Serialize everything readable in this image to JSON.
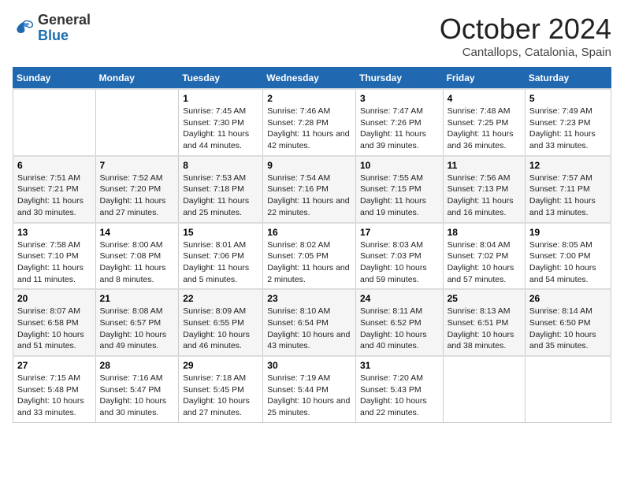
{
  "header": {
    "logo_general": "General",
    "logo_blue": "Blue",
    "month": "October 2024",
    "location": "Cantallops, Catalonia, Spain"
  },
  "days_of_week": [
    "Sunday",
    "Monday",
    "Tuesday",
    "Wednesday",
    "Thursday",
    "Friday",
    "Saturday"
  ],
  "weeks": [
    [
      {
        "day": "",
        "sunrise": "",
        "sunset": "",
        "daylight": ""
      },
      {
        "day": "",
        "sunrise": "",
        "sunset": "",
        "daylight": ""
      },
      {
        "day": "1",
        "sunrise": "Sunrise: 7:45 AM",
        "sunset": "Sunset: 7:30 PM",
        "daylight": "Daylight: 11 hours and 44 minutes."
      },
      {
        "day": "2",
        "sunrise": "Sunrise: 7:46 AM",
        "sunset": "Sunset: 7:28 PM",
        "daylight": "Daylight: 11 hours and 42 minutes."
      },
      {
        "day": "3",
        "sunrise": "Sunrise: 7:47 AM",
        "sunset": "Sunset: 7:26 PM",
        "daylight": "Daylight: 11 hours and 39 minutes."
      },
      {
        "day": "4",
        "sunrise": "Sunrise: 7:48 AM",
        "sunset": "Sunset: 7:25 PM",
        "daylight": "Daylight: 11 hours and 36 minutes."
      },
      {
        "day": "5",
        "sunrise": "Sunrise: 7:49 AM",
        "sunset": "Sunset: 7:23 PM",
        "daylight": "Daylight: 11 hours and 33 minutes."
      }
    ],
    [
      {
        "day": "6",
        "sunrise": "Sunrise: 7:51 AM",
        "sunset": "Sunset: 7:21 PM",
        "daylight": "Daylight: 11 hours and 30 minutes."
      },
      {
        "day": "7",
        "sunrise": "Sunrise: 7:52 AM",
        "sunset": "Sunset: 7:20 PM",
        "daylight": "Daylight: 11 hours and 27 minutes."
      },
      {
        "day": "8",
        "sunrise": "Sunrise: 7:53 AM",
        "sunset": "Sunset: 7:18 PM",
        "daylight": "Daylight: 11 hours and 25 minutes."
      },
      {
        "day": "9",
        "sunrise": "Sunrise: 7:54 AM",
        "sunset": "Sunset: 7:16 PM",
        "daylight": "Daylight: 11 hours and 22 minutes."
      },
      {
        "day": "10",
        "sunrise": "Sunrise: 7:55 AM",
        "sunset": "Sunset: 7:15 PM",
        "daylight": "Daylight: 11 hours and 19 minutes."
      },
      {
        "day": "11",
        "sunrise": "Sunrise: 7:56 AM",
        "sunset": "Sunset: 7:13 PM",
        "daylight": "Daylight: 11 hours and 16 minutes."
      },
      {
        "day": "12",
        "sunrise": "Sunrise: 7:57 AM",
        "sunset": "Sunset: 7:11 PM",
        "daylight": "Daylight: 11 hours and 13 minutes."
      }
    ],
    [
      {
        "day": "13",
        "sunrise": "Sunrise: 7:58 AM",
        "sunset": "Sunset: 7:10 PM",
        "daylight": "Daylight: 11 hours and 11 minutes."
      },
      {
        "day": "14",
        "sunrise": "Sunrise: 8:00 AM",
        "sunset": "Sunset: 7:08 PM",
        "daylight": "Daylight: 11 hours and 8 minutes."
      },
      {
        "day": "15",
        "sunrise": "Sunrise: 8:01 AM",
        "sunset": "Sunset: 7:06 PM",
        "daylight": "Daylight: 11 hours and 5 minutes."
      },
      {
        "day": "16",
        "sunrise": "Sunrise: 8:02 AM",
        "sunset": "Sunset: 7:05 PM",
        "daylight": "Daylight: 11 hours and 2 minutes."
      },
      {
        "day": "17",
        "sunrise": "Sunrise: 8:03 AM",
        "sunset": "Sunset: 7:03 PM",
        "daylight": "Daylight: 10 hours and 59 minutes."
      },
      {
        "day": "18",
        "sunrise": "Sunrise: 8:04 AM",
        "sunset": "Sunset: 7:02 PM",
        "daylight": "Daylight: 10 hours and 57 minutes."
      },
      {
        "day": "19",
        "sunrise": "Sunrise: 8:05 AM",
        "sunset": "Sunset: 7:00 PM",
        "daylight": "Daylight: 10 hours and 54 minutes."
      }
    ],
    [
      {
        "day": "20",
        "sunrise": "Sunrise: 8:07 AM",
        "sunset": "Sunset: 6:58 PM",
        "daylight": "Daylight: 10 hours and 51 minutes."
      },
      {
        "day": "21",
        "sunrise": "Sunrise: 8:08 AM",
        "sunset": "Sunset: 6:57 PM",
        "daylight": "Daylight: 10 hours and 49 minutes."
      },
      {
        "day": "22",
        "sunrise": "Sunrise: 8:09 AM",
        "sunset": "Sunset: 6:55 PM",
        "daylight": "Daylight: 10 hours and 46 minutes."
      },
      {
        "day": "23",
        "sunrise": "Sunrise: 8:10 AM",
        "sunset": "Sunset: 6:54 PM",
        "daylight": "Daylight: 10 hours and 43 minutes."
      },
      {
        "day": "24",
        "sunrise": "Sunrise: 8:11 AM",
        "sunset": "Sunset: 6:52 PM",
        "daylight": "Daylight: 10 hours and 40 minutes."
      },
      {
        "day": "25",
        "sunrise": "Sunrise: 8:13 AM",
        "sunset": "Sunset: 6:51 PM",
        "daylight": "Daylight: 10 hours and 38 minutes."
      },
      {
        "day": "26",
        "sunrise": "Sunrise: 8:14 AM",
        "sunset": "Sunset: 6:50 PM",
        "daylight": "Daylight: 10 hours and 35 minutes."
      }
    ],
    [
      {
        "day": "27",
        "sunrise": "Sunrise: 7:15 AM",
        "sunset": "Sunset: 5:48 PM",
        "daylight": "Daylight: 10 hours and 33 minutes."
      },
      {
        "day": "28",
        "sunrise": "Sunrise: 7:16 AM",
        "sunset": "Sunset: 5:47 PM",
        "daylight": "Daylight: 10 hours and 30 minutes."
      },
      {
        "day": "29",
        "sunrise": "Sunrise: 7:18 AM",
        "sunset": "Sunset: 5:45 PM",
        "daylight": "Daylight: 10 hours and 27 minutes."
      },
      {
        "day": "30",
        "sunrise": "Sunrise: 7:19 AM",
        "sunset": "Sunset: 5:44 PM",
        "daylight": "Daylight: 10 hours and 25 minutes."
      },
      {
        "day": "31",
        "sunrise": "Sunrise: 7:20 AM",
        "sunset": "Sunset: 5:43 PM",
        "daylight": "Daylight: 10 hours and 22 minutes."
      },
      {
        "day": "",
        "sunrise": "",
        "sunset": "",
        "daylight": ""
      },
      {
        "day": "",
        "sunrise": "",
        "sunset": "",
        "daylight": ""
      }
    ]
  ]
}
